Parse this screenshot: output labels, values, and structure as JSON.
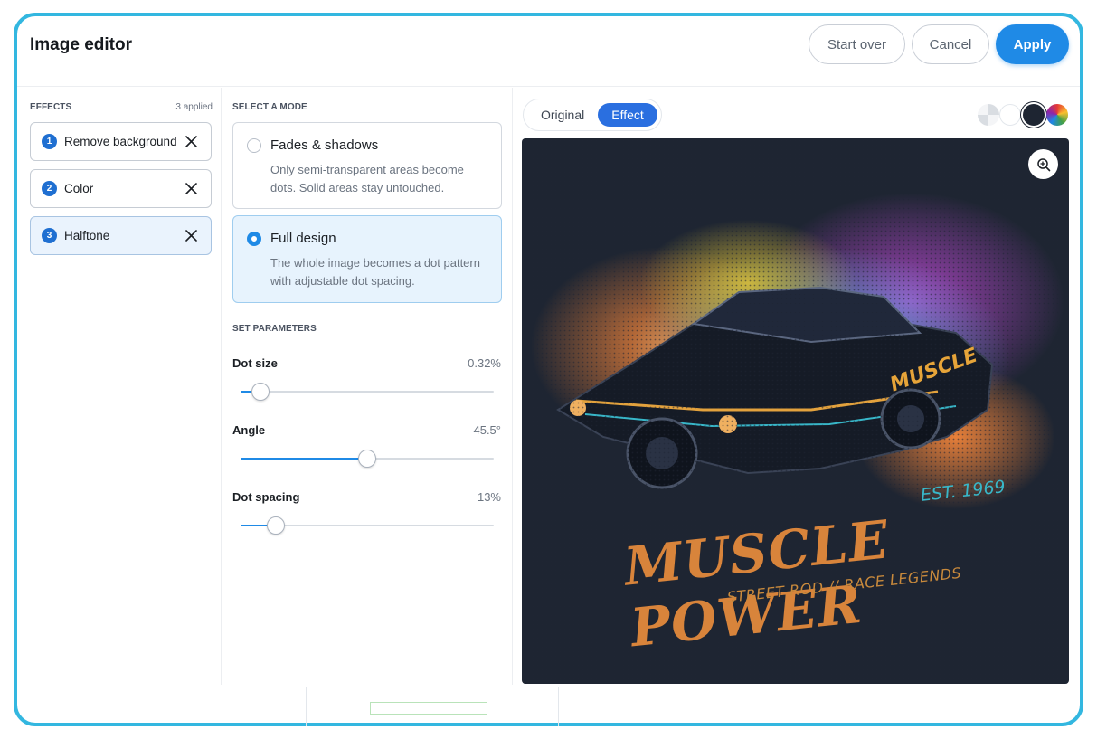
{
  "header": {
    "title": "Image editor",
    "start_over": "Start over",
    "cancel": "Cancel",
    "apply": "Apply"
  },
  "effects": {
    "label": "EFFECTS",
    "count": "3 applied",
    "items": [
      {
        "number": "1",
        "label": "Remove background",
        "icon": "close-icon"
      },
      {
        "number": "2",
        "label": "Color",
        "icon": "close-icon"
      },
      {
        "number": "3",
        "label": "Halftone",
        "icon": "close-icon",
        "active": true
      }
    ]
  },
  "modes": {
    "label": "SELECT A MODE",
    "options": [
      {
        "title": "Fades & shadows",
        "description": "Only semi-transparent areas become dots. Solid areas stay untouched.",
        "selected": false
      },
      {
        "title": "Full design",
        "description": "The whole image becomes a dot pattern with adjustable dot spacing.",
        "selected": true
      }
    ]
  },
  "parameters": {
    "label": "SET PARAMETERS",
    "items": [
      {
        "name": "Dot size",
        "value": "0.32%",
        "level": 0.08
      },
      {
        "name": "Angle",
        "value": "45.5°",
        "level": 0.5
      },
      {
        "name": "Dot spacing",
        "value": "13%",
        "level": 0.14
      }
    ]
  },
  "preview": {
    "toggle": {
      "original": "Original",
      "effect": "Effect",
      "selected": "Effect"
    },
    "backgrounds": [
      "transparent-checker",
      "white",
      "dark-navy",
      "rainbow"
    ],
    "selected_background": "dark-navy",
    "canvas_color": "#1e2532",
    "zoom_icon": "zoom-in-icon",
    "artwork_text": {
      "headline": "MUSCLE POWER",
      "tagline": "STREET ROD // RACE LEGENDS",
      "est": "EST. 1969",
      "door": "MUSCLE"
    }
  },
  "colors": {
    "accent": "#1f8ae6",
    "frame": "#33b7e0",
    "badge": "#1f6fd1"
  }
}
